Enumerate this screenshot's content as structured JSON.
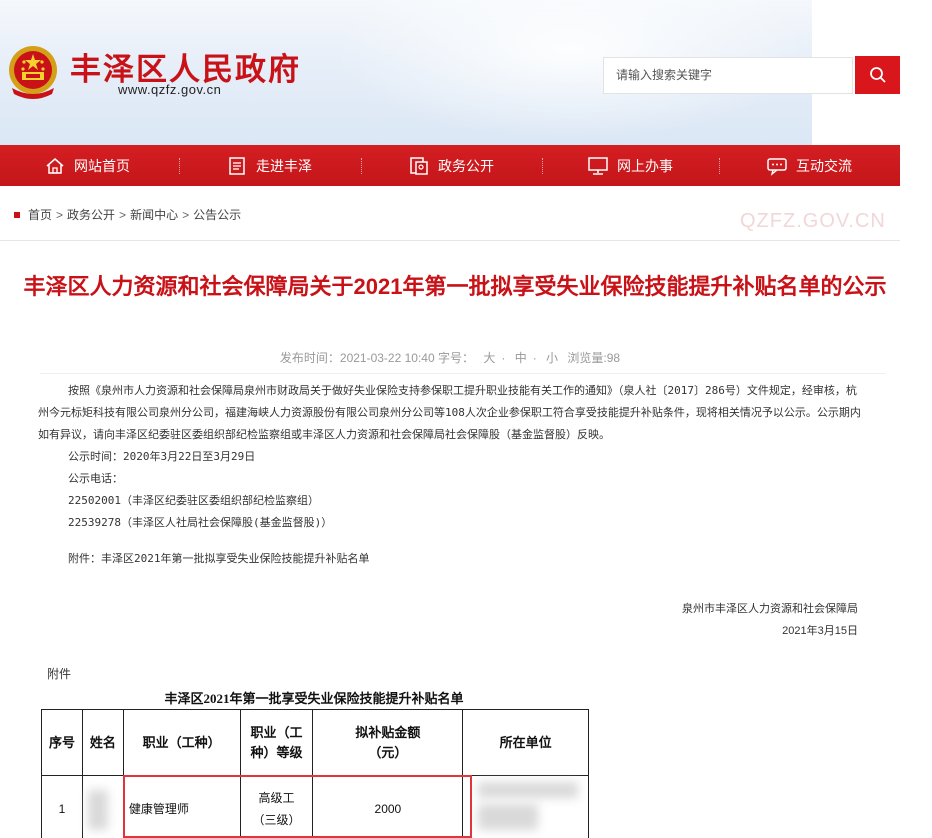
{
  "header": {
    "site_title": "丰泽区人民政府",
    "site_url": "www.qzfz.gov.cn",
    "search_placeholder": "请输入搜索关键字"
  },
  "nav": [
    {
      "label": "网站首页",
      "icon": "home-icon"
    },
    {
      "label": "走进丰泽",
      "icon": "document-icon"
    },
    {
      "label": "政务公开",
      "icon": "files-icon"
    },
    {
      "label": "网上办事",
      "icon": "monitor-icon"
    },
    {
      "label": "互动交流",
      "icon": "chat-icon"
    }
  ],
  "breadcrumb": [
    "首页",
    "政务公开",
    "新闻中心",
    "公告公示"
  ],
  "breadcrumb_sep": ">",
  "watermark": "QZFZ.GOV.CN",
  "article": {
    "title": "丰泽区人力资源和社会保障局关于2021年第一批拟享受失业保险技能提升补贴名单的公示",
    "meta_prefix": "发布时间：2021-03-22 10:40 字号：",
    "size_large": "大",
    "size_mid": "中",
    "size_small": "小",
    "views": "浏览量:98",
    "para1": "按照《泉州市人力资源和社会保障局泉州市财政局关于做好失业保险支持参保职工提升职业技能有关工作的通知》（泉人社〔2017〕286号）文件规定，经审核，杭州今元标矩科技有限公司泉州分公司，福建海峡人力资源股份有限公司泉州分公司等108人次企业参保职工符合享受技能提升补贴条件，现将相关情况予以公示。公示期内如有异议，请向丰泽区纪委驻区委组织部纪检监察组或丰泽区人力资源和社会保障局社会保障股（基金监督股）反映。",
    "period": "公示时间：2020年3月22日至3月29日",
    "phone_label": "公示电话：",
    "phone1": "22502001（丰泽区纪委驻区委组织部纪检监察组）",
    "phone2": "22539278（丰泽区人社局社会保障股(基金监督股)）",
    "attachment": "附件：丰泽区2021年第一批拟享受失业保险技能提升补贴名单",
    "signature_org": "泉州市丰泽区人力资源和社会保障局",
    "signature_date": "2021年3月15日"
  },
  "attach_section": {
    "label": "附件",
    "table_title": "丰泽区2021年第一批享受失业保险技能提升补贴名单",
    "headers": {
      "seq": "序号",
      "name": "姓名",
      "job": "职业（工种）",
      "level": "职业（工种）等级",
      "amount": "拟补贴金额（元）",
      "unit": "所在单位"
    },
    "rows": [
      {
        "seq": "1",
        "name": "",
        "job": "健康管理师",
        "level": "高级工（三级）",
        "amount": "2000",
        "unit": ""
      }
    ]
  },
  "colors": {
    "brand_red": "#c81217",
    "nav_red": "#d41e22",
    "highlight": "#e0353b"
  }
}
